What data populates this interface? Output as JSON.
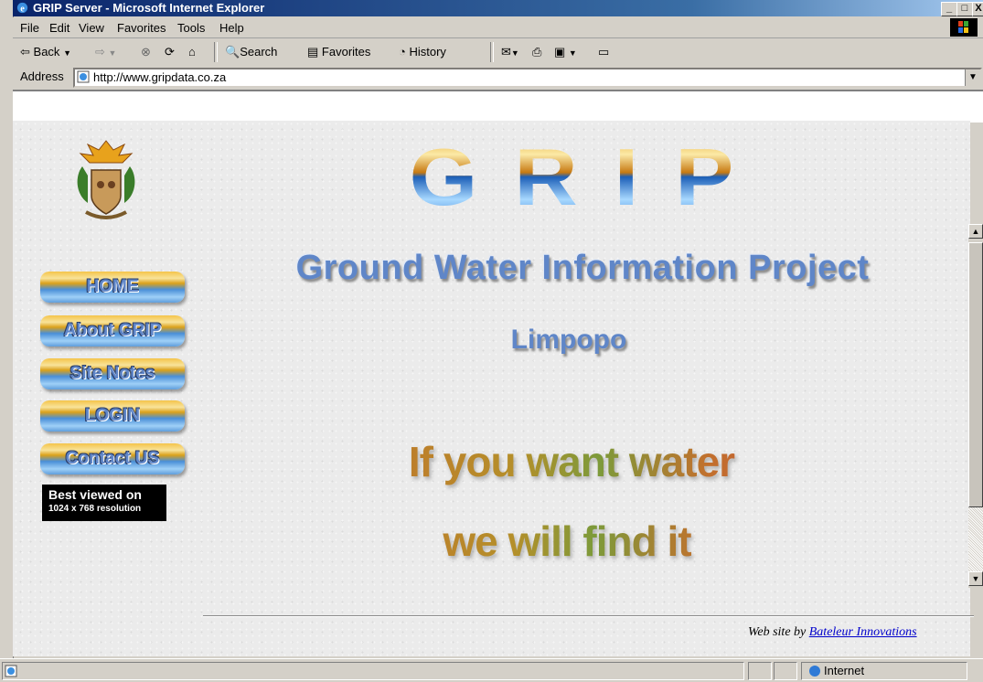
{
  "window": {
    "title": "GRIP Server - Microsoft Internet Explorer",
    "minimize_label": "_",
    "maximize_label": "□",
    "close_label": "X"
  },
  "menu": [
    "File",
    "Edit",
    "View",
    "Favorites",
    "Tools",
    "Help"
  ],
  "toolbar": {
    "back_label": "Back",
    "search_label": "Search",
    "favorites_label": "Favorites",
    "history_label": "History"
  },
  "address": {
    "label": "Address",
    "url": "http://www.gripdata.co.za"
  },
  "page": {
    "logo_text": "GRIP",
    "subtitle": "Ground Water Information Project",
    "region": "Limpopo",
    "slogan_line1": "If you want water",
    "slogan_line2": "we will find it",
    "nav": [
      "HOME",
      "About GRIP",
      "Site Notes",
      "LOGIN",
      "Contact US"
    ],
    "best_viewed_line1": "Best viewed on",
    "best_viewed_line2": "1024 x 768 resolution",
    "credit_prefix": "Web site by",
    "credit_link": "Bateleur Innovations"
  },
  "status": {
    "zone": "Internet"
  },
  "colors": {
    "titlebar": "#0a246a",
    "nav_text": "#5f86c8",
    "link": "#0000cc"
  }
}
